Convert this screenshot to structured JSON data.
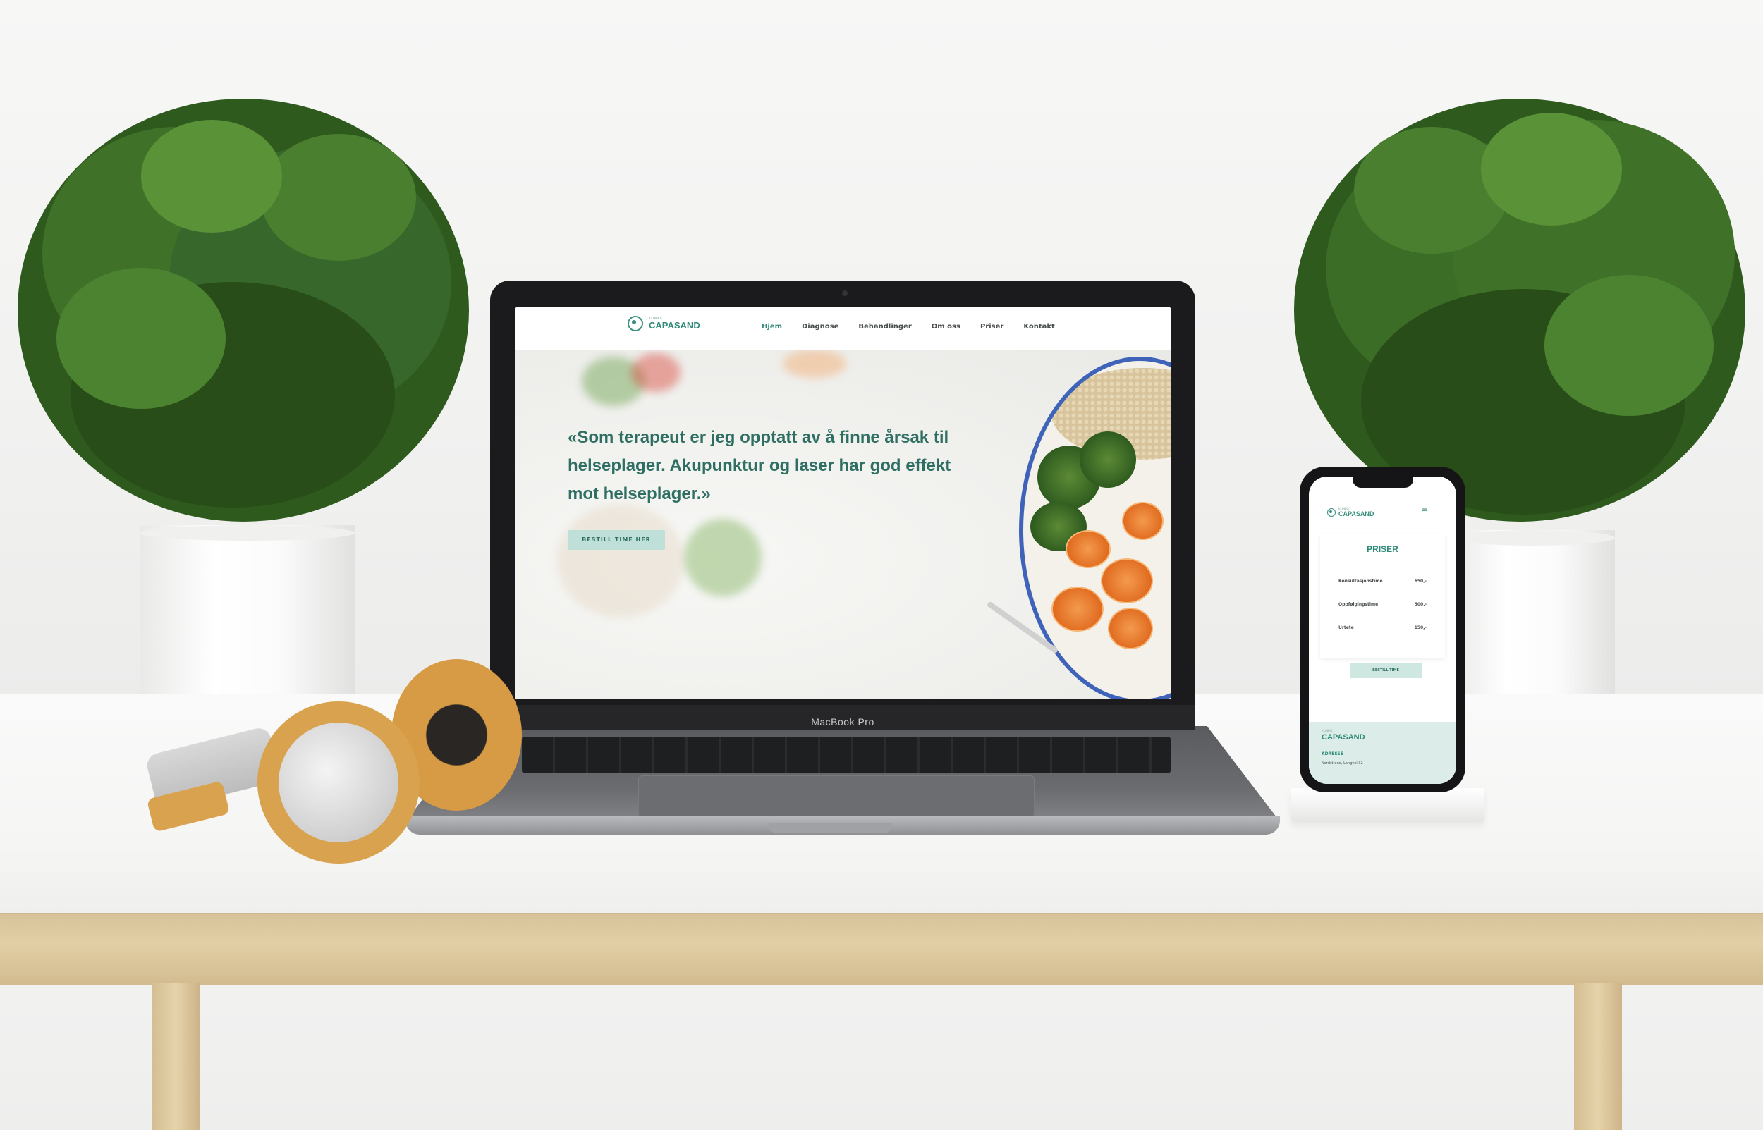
{
  "laptop": {
    "brand_label": "MacBook Pro"
  },
  "website": {
    "logo": {
      "small": "KLINIKK",
      "name": "CAPASAND"
    },
    "nav": [
      {
        "label": "Hjem",
        "active": true
      },
      {
        "label": "Diagnose",
        "active": false
      },
      {
        "label": "Behandlinger",
        "active": false
      },
      {
        "label": "Om oss",
        "active": false
      },
      {
        "label": "Priser",
        "active": false
      },
      {
        "label": "Kontakt",
        "active": false
      }
    ],
    "hero": {
      "quote": "«Som terapeut er jeg opptatt av å finne årsak til helseplager. Akupunktur og laser har god effekt mot helseplager.»",
      "cta_label": "BESTILL TIME HER"
    },
    "accent_color": "#2f8a78"
  },
  "phone": {
    "logo": {
      "small": "KLINIKK",
      "name": "CAPASAND"
    },
    "menu_icon": "hamburger-icon",
    "prices": {
      "title": "PRISER",
      "rows": [
        {
          "label": "Konsultasjonstime",
          "price": "650,-"
        },
        {
          "label": "Oppfølgingstime",
          "price": "500,-"
        },
        {
          "label": "Urtete",
          "price": "150,-"
        }
      ],
      "button_label": "BESTILL TIME"
    },
    "footer": {
      "logo_small": "KLINIKK",
      "logo_name": "CAPASAND",
      "address_label": "ADRESSE",
      "address_text": "Nordstrand, Langvei 32"
    }
  }
}
